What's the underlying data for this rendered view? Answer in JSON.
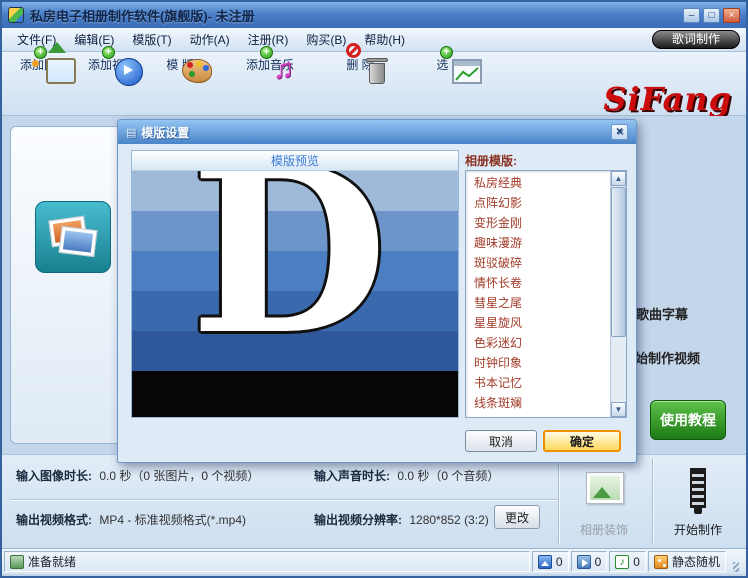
{
  "window": {
    "title": "私房电子相册制作软件(旗舰版)- 未注册",
    "controls": {
      "min": "–",
      "max": "□",
      "close": "×"
    }
  },
  "menu": {
    "items": [
      "文件(F)",
      "编辑(E)",
      "模版(T)",
      "动作(A)",
      "注册(R)",
      "购买(B)",
      "帮助(H)"
    ],
    "lyrics_button": "歌词制作"
  },
  "toolbar": {
    "logo": "SiFang",
    "buttons": [
      {
        "label": "添加图片",
        "icon": "add-image-icon"
      },
      {
        "label": "添加视频",
        "icon": "add-video-icon"
      },
      {
        "label": "模 版",
        "icon": "template-icon"
      },
      {
        "label": "添加音乐",
        "icon": "add-music-icon"
      },
      {
        "label": "删 除",
        "icon": "delete-icon"
      },
      {
        "label": "选 项",
        "icon": "options-icon"
      }
    ]
  },
  "content": {
    "song_caption": "歌曲字幕",
    "start_video": "开始制作视频",
    "tutorial_button": "使用教程"
  },
  "dialog": {
    "title": "模版设置",
    "icon_glyph": "▤",
    "close_glyph": "×",
    "preview_header": "模版预览",
    "preview_letter": "D",
    "list_label": "相册模版:",
    "templates": [
      "私房经典",
      "点阵幻影",
      "变形金刚",
      "趣味漫游",
      "斑驳破碎",
      "情怀长卷",
      "彗星之尾",
      "星星旋风",
      "色彩迷幻",
      "时钟印象",
      "书本记忆",
      "线条斑斓"
    ],
    "scroll_up": "▲",
    "scroll_down": "▼",
    "cancel_button": "取消",
    "ok_button": "确定"
  },
  "info": {
    "image_duration_label": "输入图像时长:",
    "image_duration_value": "0.0 秒（0 张图片，0 个视频）",
    "audio_duration_label": "输入声音时长:",
    "audio_duration_value": "0.0 秒（0 个音频）",
    "format_label": "输出视频格式:",
    "format_value": "MP4 - 标准视频格式(*.mp4)",
    "resolution_label": "输出视频分辨率:",
    "resolution_value": "1280*852 (3:2)",
    "change_button": "更改",
    "album_decor_button": "相册装饰",
    "start_make_button": "开始制作"
  },
  "statusbar": {
    "ready": "准备就绪",
    "image_count": "0",
    "video_count": "0",
    "music_count": "0",
    "mode": "静态随机"
  },
  "colors": {
    "accent_blue": "#3a6cb8",
    "logo_red": "#cc0c0c",
    "ok_orange": "#f09000",
    "tutorial_green": "#1c7a14"
  }
}
